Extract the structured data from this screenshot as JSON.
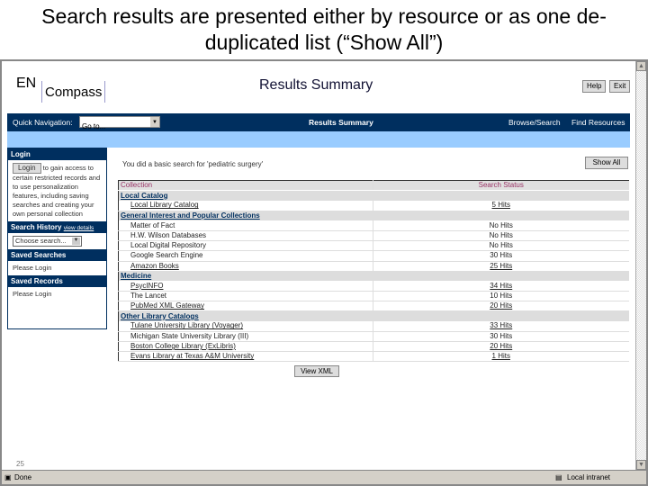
{
  "slide_title": "Search results are presented either by resource or as one de-duplicated list (“Show All”)",
  "header": {
    "logo_en": "EN",
    "logo_compass": "Compass",
    "page_title": "Results Summary",
    "help": "Help",
    "exit": "Exit"
  },
  "nav": {
    "quick_nav_label": "Quick Navigation:",
    "goto": "Go to...",
    "current": "Results Summary",
    "browse": "Browse/Search",
    "find": "Find Resources"
  },
  "sidebar": {
    "login_head": "Login",
    "login_btn": "Login",
    "login_text": "to gain access to certain restricted records and to use personalization features, including saving searches and creating your own personal collection",
    "history_head": "Search History",
    "view_details": "view details",
    "choose": "Choose search...",
    "saved_searches": "Saved Searches",
    "please_login1": "Please Login",
    "saved_records": "Saved Records",
    "please_login2": "Please Login"
  },
  "main": {
    "searched": "You did a basic search for 'pediatric surgery'",
    "show_all": "Show All",
    "col_collection": "Collection",
    "col_status": "Search Status",
    "view_xml": "View XML",
    "rows": [
      {
        "type": "grp",
        "name": "Local Catalog"
      },
      {
        "type": "it",
        "name": "Local Library Catalog",
        "status": "5 Hits",
        "link": true
      },
      {
        "type": "grp",
        "name": "General Interest and Popular Collections"
      },
      {
        "type": "it",
        "name": "Matter of Fact",
        "status": "No Hits"
      },
      {
        "type": "it",
        "name": "H.W. Wilson Databases",
        "status": "No Hits"
      },
      {
        "type": "it",
        "name": "Local Digital Repository",
        "status": "No Hits"
      },
      {
        "type": "it",
        "name": "Google Search Engine",
        "status": "30 Hits"
      },
      {
        "type": "it",
        "name": "Amazon Books",
        "status": "25 Hits",
        "link": true
      },
      {
        "type": "grp",
        "name": "Medicine"
      },
      {
        "type": "it",
        "name": "PsycINFO",
        "status": "34 Hits",
        "link": true
      },
      {
        "type": "it",
        "name": "The Lancet",
        "status": "10 Hits"
      },
      {
        "type": "it",
        "name": "PubMed XML Gateway",
        "status": "20 Hits",
        "link": true
      },
      {
        "type": "grp",
        "name": "Other Library Catalogs"
      },
      {
        "type": "it",
        "name": "Tulane University Library (Voyager)",
        "status": "33 Hits",
        "link": true
      },
      {
        "type": "it",
        "name": "Michigan State University Library (III)",
        "status": "30 Hits"
      },
      {
        "type": "it",
        "name": "Boston College Library (ExLibris)",
        "status": "20 Hits",
        "link": true
      },
      {
        "type": "it",
        "name": "Evans Library at Texas A&M University",
        "status": "1 Hits",
        "link": true
      }
    ]
  },
  "page_number": "25",
  "statusbar": {
    "done": "Done",
    "zone": "Local intranet"
  }
}
